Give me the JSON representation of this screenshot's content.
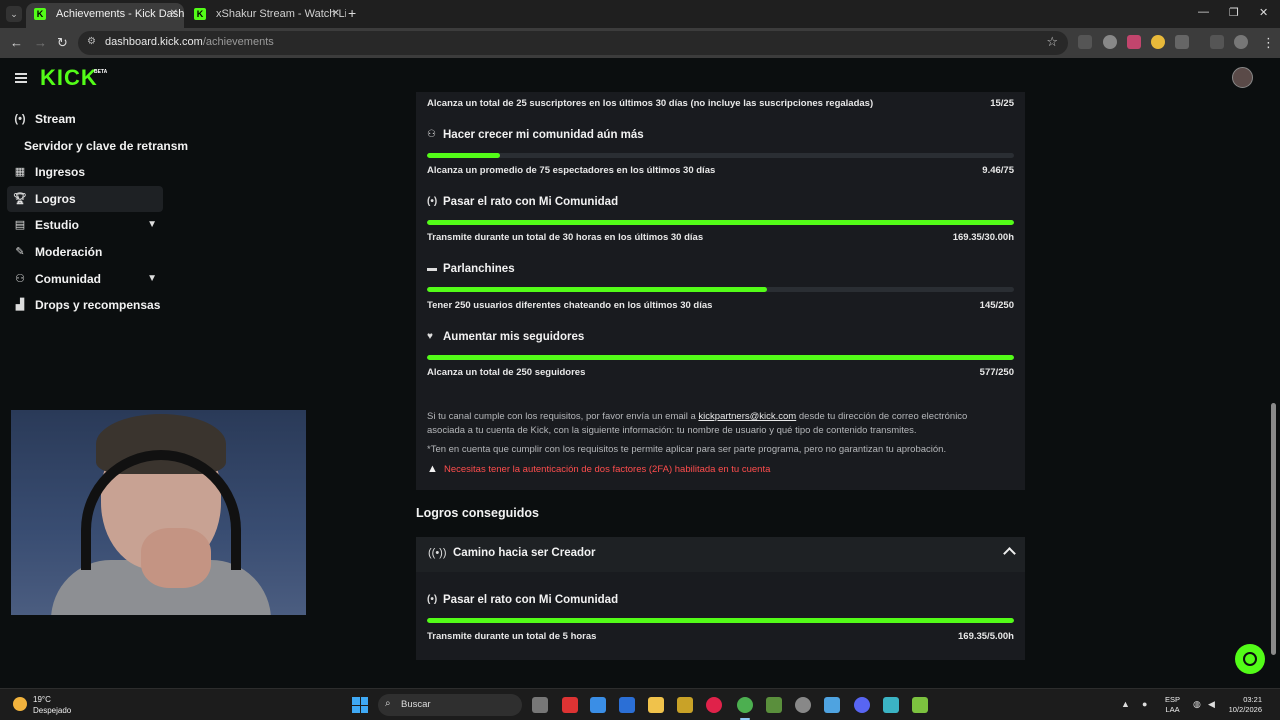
{
  "browser": {
    "tabs": [
      {
        "title": "Achievements - Kick Dashboard",
        "active": true
      },
      {
        "title": "xShakur Stream - Watch Live on Kick",
        "active": false
      }
    ],
    "url_host": "dashboard.kick.com",
    "url_path": "/achievements"
  },
  "brand": {
    "logo": "KICK",
    "beta": "BETA",
    "accent": "#53fc18"
  },
  "sidebar": {
    "items": [
      {
        "label": "Stream",
        "icon": "broadcast-icon"
      },
      {
        "label": "Servidor y clave de retransm",
        "icon": null
      },
      {
        "label": "Ingresos",
        "icon": "chart-icon"
      },
      {
        "label": "Logros",
        "icon": "trophy-icon",
        "active": true
      },
      {
        "label": "Estudio",
        "icon": "studio-icon",
        "expandable": true
      },
      {
        "label": "Moderación",
        "icon": "wrench-icon"
      },
      {
        "label": "Comunidad",
        "icon": "community-icon",
        "expandable": true
      },
      {
        "label": "Drops y recompensas",
        "icon": "rewards-icon"
      }
    ]
  },
  "achievements": {
    "top_partial": {
      "description": "Alcanza un total de 25 suscriptores en los últimos 30 días (no incluye las suscripciones regaladas)",
      "value": "15/25"
    },
    "items": [
      {
        "title": "Hacer crecer mi comunidad aún más",
        "icon": "users-icon",
        "progress": 0.125,
        "description": "Alcanza un promedio de 75 espectadores en los últimos 30 días",
        "value": "9.46/75"
      },
      {
        "title": "Pasar el rato con Mi Comunidad",
        "icon": "broadcast-icon",
        "progress": 1.0,
        "description": "Transmite durante un total de 30 horas en los últimos 30 días",
        "value": "169.35/30.00h"
      },
      {
        "title": "Parlanchines",
        "icon": "chat-icon",
        "progress": 0.58,
        "description": "Tener 250 usuarios diferentes chateando en los últimos 30 días",
        "value": "145/250"
      },
      {
        "title": "Aumentar mis seguidores",
        "icon": "heart-icon",
        "progress": 1.0,
        "description": "Alcanza un total de 250 seguidores",
        "value": "577/250"
      }
    ],
    "info_text_1": "Si tu canal cumple con los requisitos, por favor envía un email a ",
    "info_email": "kickpartners@kick.com",
    "info_text_2": " desde tu dirección de correo electrónico asociada a tu cuenta de Kick, con la siguiente información: tu nombre de usuario y qué tipo de contenido transmites.",
    "note": "*Ten en cuenta que cumplir con los requisitos te permite aplicar para ser parte programa, pero no garantizan tu aprobación.",
    "warning": "Necesitas tener la autenticación de dos factores (2FA) habilitada en tu cuenta"
  },
  "completed": {
    "heading": "Logros conseguidos",
    "group_title": "Camino hacia ser Creador",
    "item": {
      "title": "Pasar el rato con Mi Comunidad",
      "progress": 1.0,
      "description": "Transmite durante un total de 5 horas",
      "value": "169.35/5.00h"
    }
  },
  "taskbar": {
    "temp": "19°C",
    "weather": "Despejado",
    "search": "Buscar",
    "lang_1": "ESP",
    "lang_2": "LAA",
    "time": "03:21",
    "date": "10/2/2026"
  }
}
